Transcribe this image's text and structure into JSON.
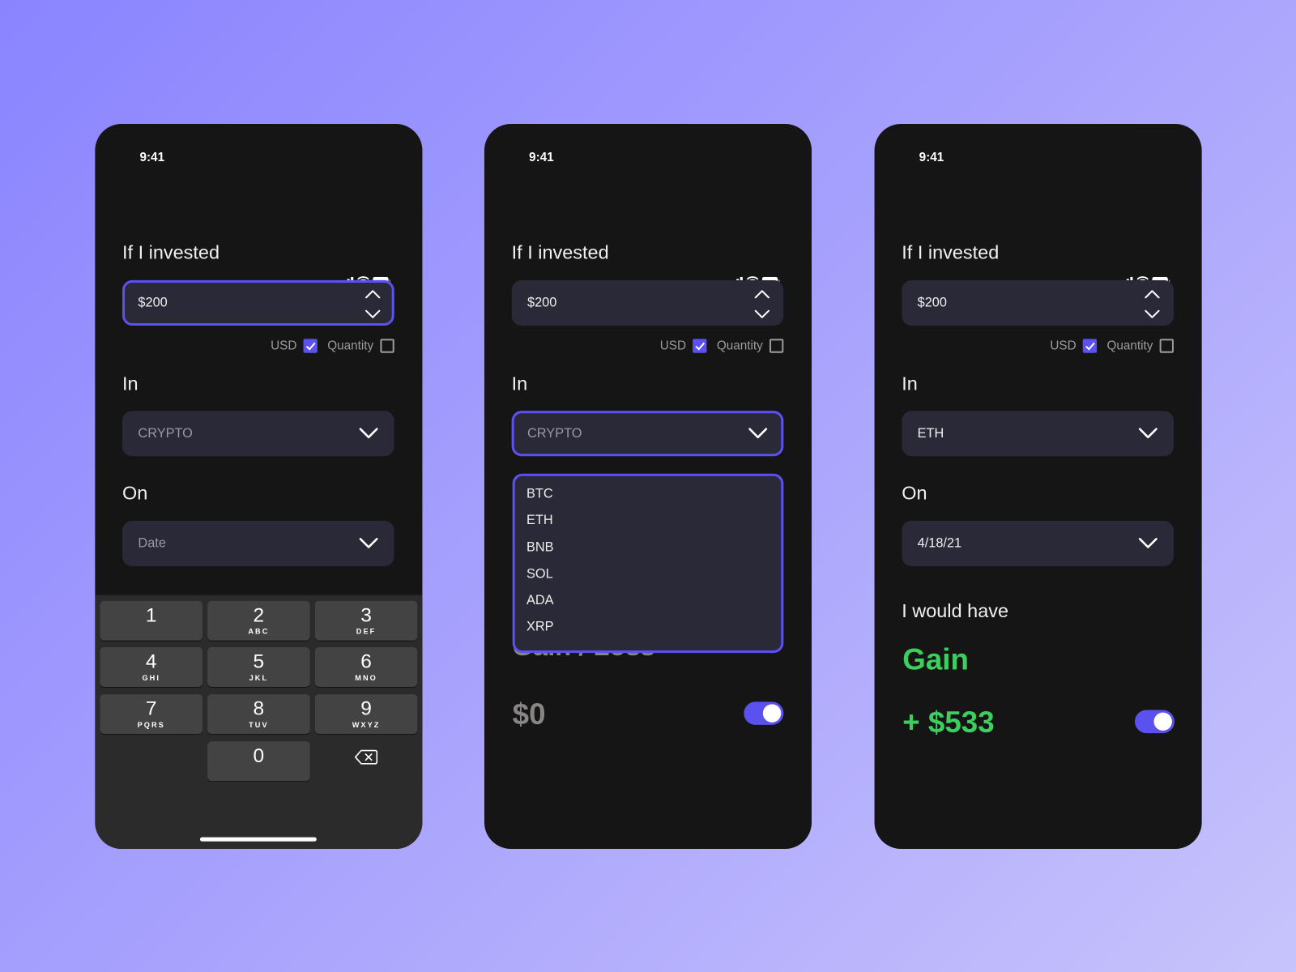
{
  "colors": {
    "accent": "#5b50f0",
    "gain": "#3ccf5e",
    "field_bg": "#2a2938",
    "screen_bg": "#151515"
  },
  "screens": [
    {
      "time": "9:41",
      "invested_label": "If I invested",
      "amount": "$200",
      "usd_label": "USD",
      "usd_checked": true,
      "quantity_label": "Quantity",
      "quantity_checked": false,
      "in_label": "In",
      "in_placeholder": "CRYPTO",
      "on_label": "On",
      "date_placeholder": "Date",
      "keypad": [
        {
          "n": "1",
          "l": ""
        },
        {
          "n": "2",
          "l": "ABC"
        },
        {
          "n": "3",
          "l": "DEF"
        },
        {
          "n": "4",
          "l": "GHI"
        },
        {
          "n": "5",
          "l": "JKL"
        },
        {
          "n": "6",
          "l": "MNO"
        },
        {
          "n": "7",
          "l": "PQRS"
        },
        {
          "n": "8",
          "l": "TUV"
        },
        {
          "n": "9",
          "l": "WXYZ"
        },
        {
          "n": "0",
          "l": ""
        }
      ]
    },
    {
      "time": "9:41",
      "invested_label": "If I invested",
      "amount": "$200",
      "usd_label": "USD",
      "usd_checked": true,
      "quantity_label": "Quantity",
      "quantity_checked": false,
      "in_label": "In",
      "in_placeholder": "CRYPTO",
      "options": [
        "BTC",
        "ETH",
        "BNB",
        "SOL",
        "ADA",
        "XRP"
      ],
      "result_label": "Gain / Loss",
      "result_value": "$0",
      "toggle_on": true
    },
    {
      "time": "9:41",
      "invested_label": "If I invested",
      "amount": "$200",
      "usd_label": "USD",
      "usd_checked": true,
      "quantity_label": "Quantity",
      "quantity_checked": false,
      "in_label": "In",
      "in_value": "ETH",
      "on_label": "On",
      "date_value": "4/18/21",
      "would_have_label": "I would have",
      "result_label": "Gain",
      "result_value": "+ $533",
      "toggle_on": true
    }
  ]
}
